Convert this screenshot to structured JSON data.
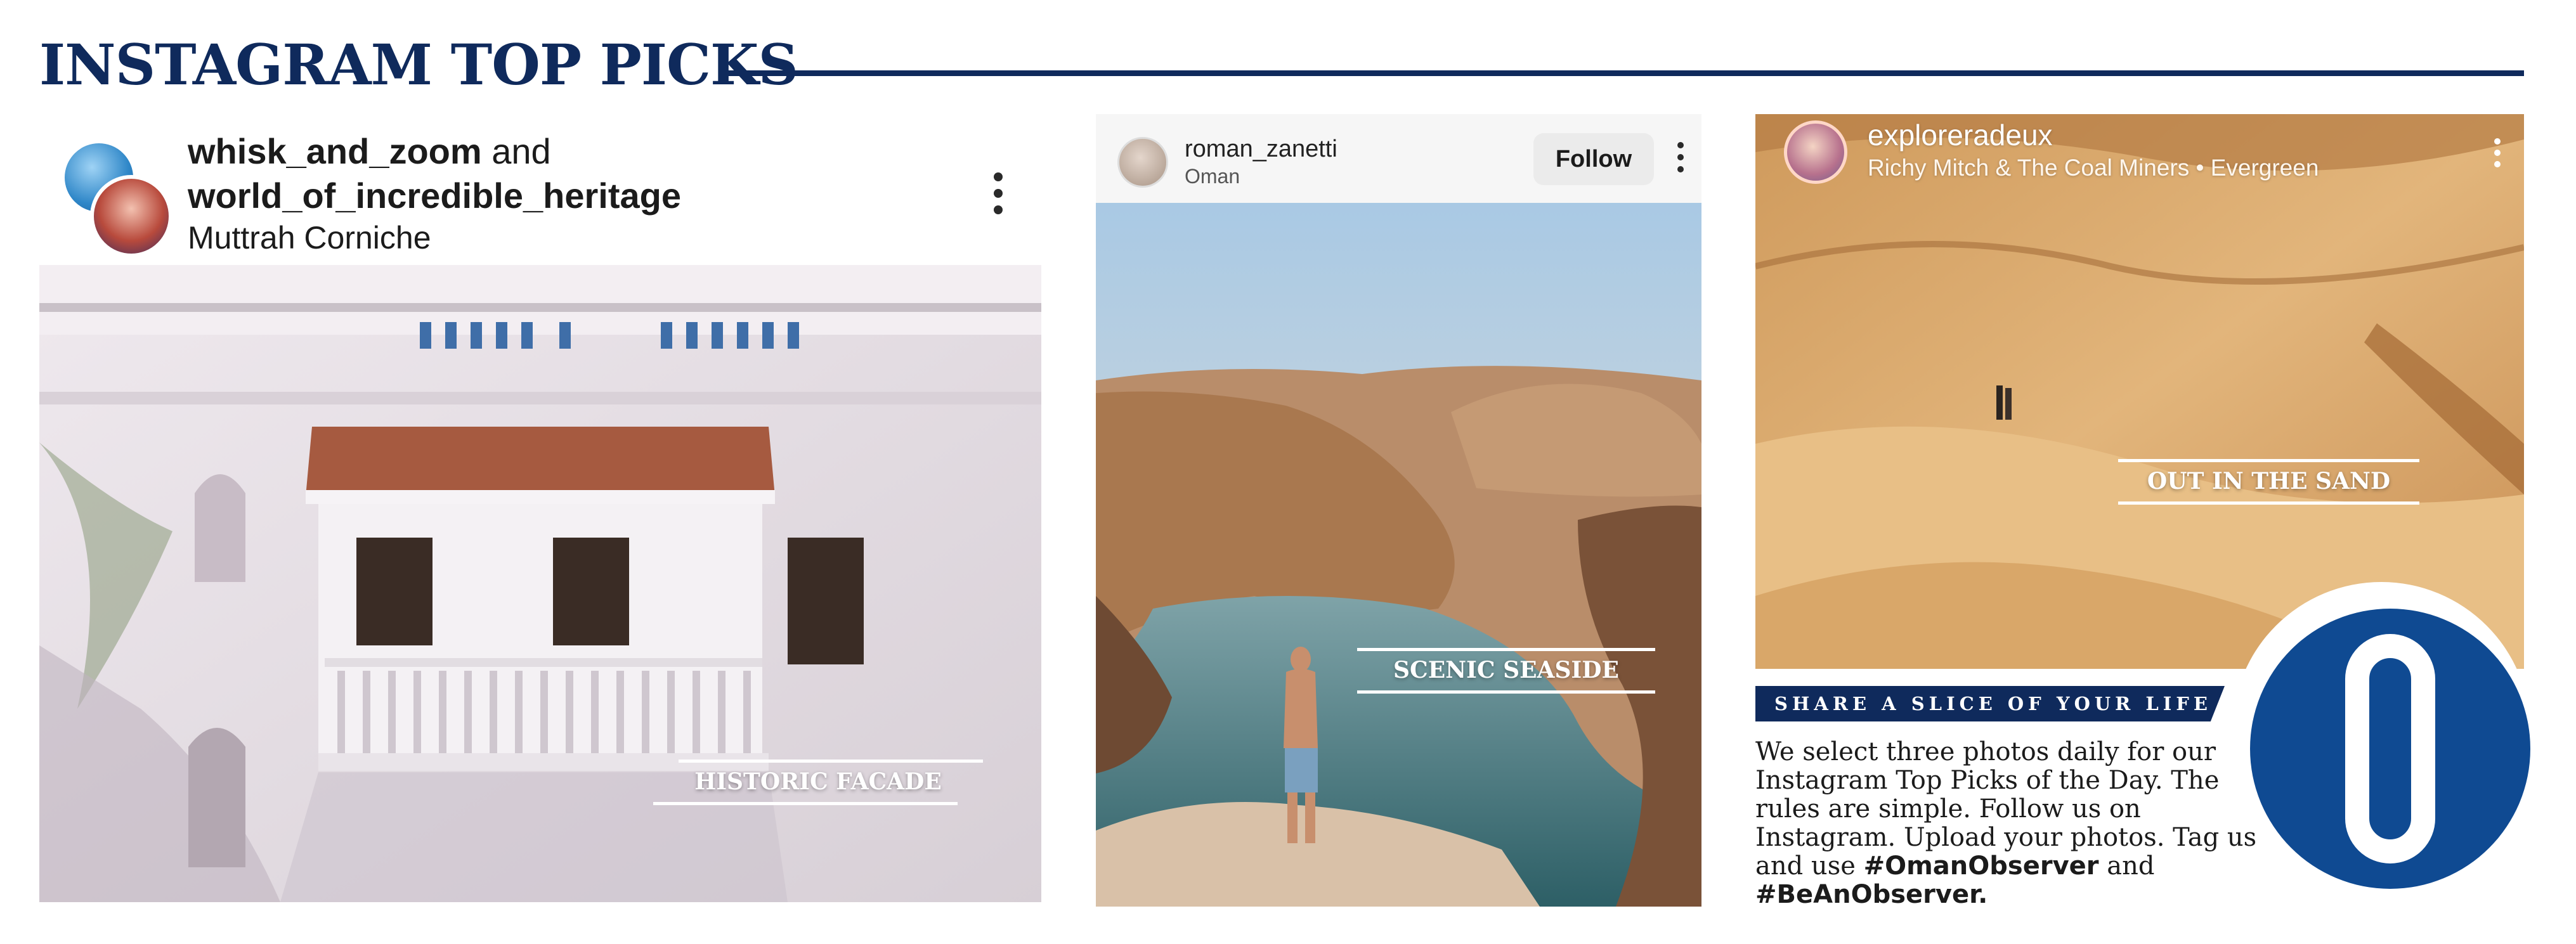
{
  "header": {
    "title": "INSTAGRAM TOP PICKS"
  },
  "posts": [
    {
      "users": [
        "whisk_and_zoom",
        "world_of_incredible_heritage"
      ],
      "joiner": "and",
      "location": "Muttrah Corniche",
      "caption": "HISTORIC FACADE",
      "menu_icon": "more-vertical-icon"
    },
    {
      "user": "roman_zanetti",
      "location": "Oman",
      "follow_label": "Follow",
      "caption": "SCENIC SEASIDE",
      "menu_icon": "more-vertical-icon"
    },
    {
      "user": "exploreradeux",
      "subtitle": "Richy Mitch & The Coal Miners • Evergreen",
      "caption": "OUT IN THE SAND",
      "menu_icon": "more-vertical-icon"
    }
  ],
  "share": {
    "banner": "SHARE A SLICE OF YOUR LIFE",
    "body": "We select three photos daily for our Instagram Top Picks of the Day. The rules are simple. Follow us on Instagram. Upload your photos. Tag us and use",
    "hashtag1": "#OmanObserver",
    "and": "and",
    "hashtag2": "#BeAnObserver."
  },
  "colors": {
    "navy": "#0f2a5c",
    "logo_blue": "#0f4a92",
    "white": "#ffffff"
  },
  "logo": {
    "letter_icon": "observer-o-logo"
  }
}
